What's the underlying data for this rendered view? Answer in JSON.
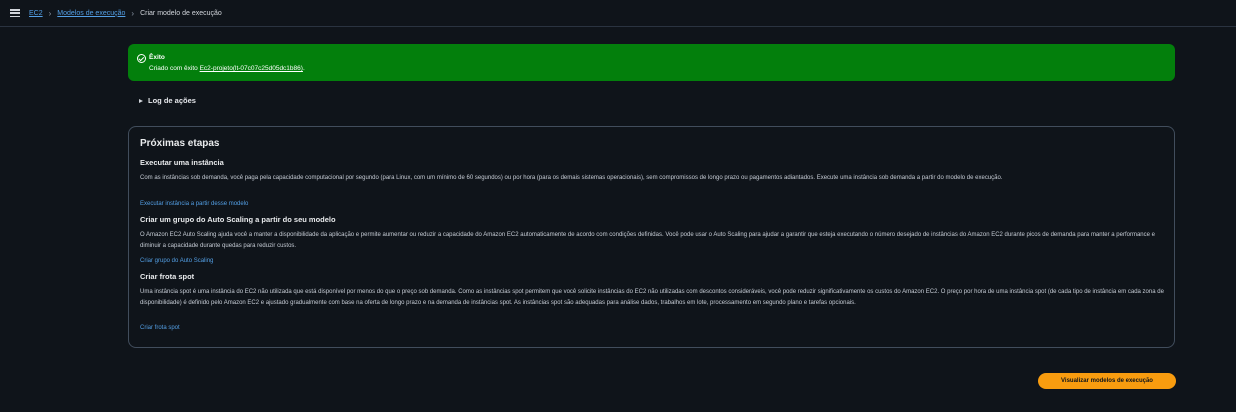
{
  "breadcrumb": {
    "items": [
      "EC2",
      "Modelos de execução"
    ],
    "current": "Criar modelo de execução"
  },
  "banner": {
    "title": "Êxito",
    "message_prefix": "Criado com êxito",
    "template_id": "Ec2-projeto(lt-07c07c25d05dc1b86)",
    "message_suffix": "."
  },
  "log": {
    "label": "Log de ações"
  },
  "next_steps": {
    "title": "Próximas etapas",
    "sections": [
      {
        "title": "Executar uma instância",
        "text": "Com as instâncias sob demanda, você paga pela capacidade computacional por segundo (para Linux, com um mínimo de 60 segundos) ou por hora (para os demais sistemas operacionais), sem compromissos de longo prazo ou pagamentos adiantados. Execute uma instância sob demanda a partir do modelo de execução.",
        "link": "Executar instância a partir desse modelo"
      },
      {
        "title": "Criar um grupo do Auto Scaling a partir do seu modelo",
        "text": "O Amazon EC2 Auto Scaling ajuda você a manter a disponibilidade da aplicação e permite aumentar ou reduzir a capacidade do Amazon EC2 automaticamente de acordo com condições definidas. Você pode usar o Auto Scaling para ajudar a garantir que esteja executando o número desejado de instâncias do Amazon EC2 durante picos de demanda para manter a performance e diminuir a capacidade durante quedas para reduzir custos.",
        "link": "Criar grupo do Auto Scaling"
      },
      {
        "title": "Criar frota spot",
        "text": "Uma instância spot é uma instância do EC2 não utilizada que está disponível por menos do que o preço sob demanda. Como as instâncias spot permitem que você solicite instâncias do EC2 não utilizadas com descontos consideráveis, você pode reduzir significativamente os custos do Amazon EC2. O preço por hora de uma instância spot (de cada tipo de instância em cada zona de disponibilidade) é definido pelo Amazon EC2 e ajustado gradualmente com base na oferta de longo prazo e na demanda de instâncias spot. As instâncias spot são adequadas para análise dados, trabalhos em lote, processamento em segundo plano e tarefas opcionais.",
        "link": "Criar frota spot"
      }
    ]
  },
  "footer": {
    "view_button": "Visualizar modelos de execução"
  },
  "colors": {
    "success": "#037f0c",
    "link": "#539fe5",
    "primary": "#f89c0f",
    "background": "#0f141a"
  }
}
